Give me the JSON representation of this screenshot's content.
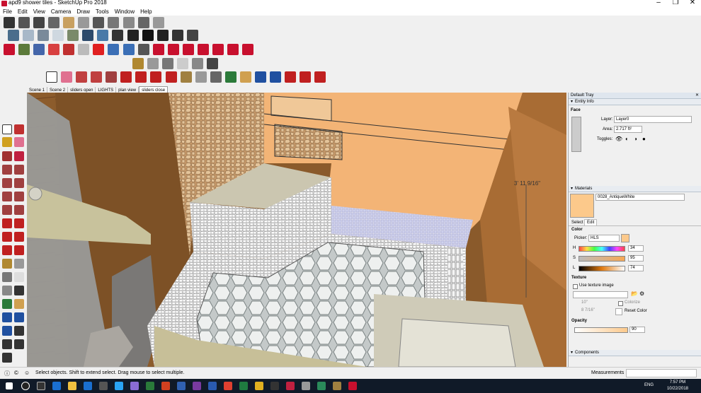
{
  "window": {
    "title": "apd9 shower tiles - SketchUp Pro 2018"
  },
  "menus": [
    "File",
    "Edit",
    "View",
    "Camera",
    "Draw",
    "Tools",
    "Window",
    "Help"
  ],
  "scenes": [
    "Scene 1",
    "Scene 2",
    "sliders open",
    "LIGHTS",
    "plan view",
    "sliders close"
  ],
  "viewport": {
    "dimension_label": "3' 11 9/16\""
  },
  "tray": {
    "title": "Default Tray",
    "entity_info": {
      "section": "Entity Info",
      "type": "Face",
      "layer_label": "Layer:",
      "layer_value": "Layer0",
      "area_label": "Area:",
      "area_value": "2.717 ft²",
      "toggles_label": "Toggles:"
    },
    "materials": {
      "section": "Materials",
      "name": "0028_AntiqueWhite",
      "tab_select": "Select",
      "tab_edit": "Edit",
      "color_label": "Color",
      "picker_label": "Picker:",
      "picker_value": "HLS",
      "h_label": "H",
      "h_value": "34",
      "s_label": "S",
      "s_value": "95",
      "l_label": "L",
      "l_value": "74",
      "texture_label": "Texture",
      "use_texture": "Use texture image",
      "width_value": "10\"",
      "height_value": "8 7/16\"",
      "colorize": "Colorize",
      "reset_color": "Reset Color",
      "opacity_label": "Opacity",
      "opacity_value": "90",
      "swatch_color": "#fcc98b"
    },
    "components": {
      "section": "Components"
    }
  },
  "status": {
    "message": "Select objects. Shift to extend select. Drag mouse to select multiple.",
    "measurements_label": "Measurements"
  },
  "taskbar": {
    "lang": "ENG",
    "time": "7:57 PM",
    "date": "10/22/2018"
  }
}
